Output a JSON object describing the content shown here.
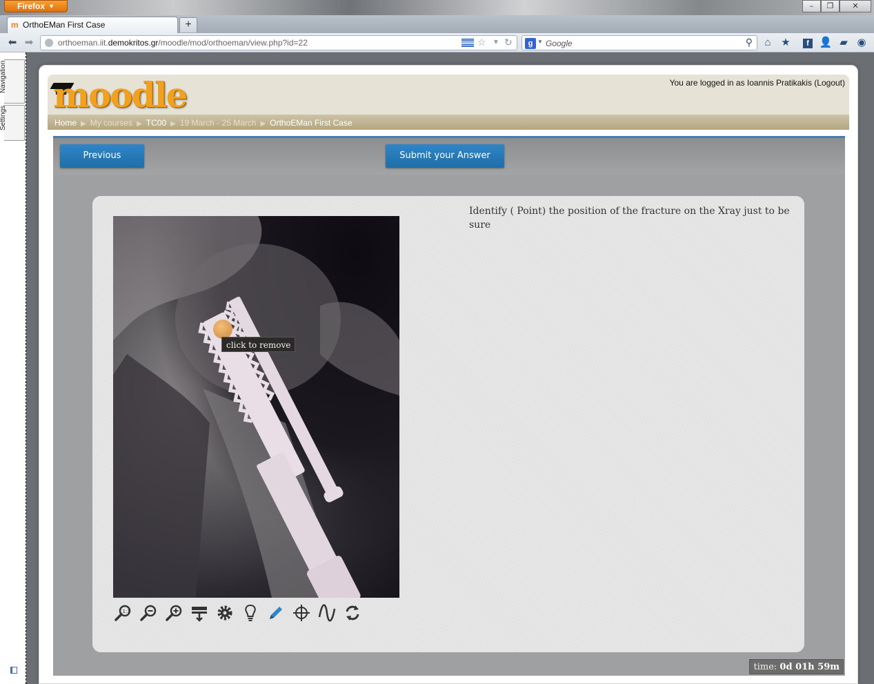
{
  "browser": {
    "app_button": "Firefox",
    "tab_title": "OrthoEMan First Case",
    "url_prefix": "orthoeman.iit.",
    "url_domain": "demokritos.gr",
    "url_path": "/moodle/mod/orthoeman/view.php?id=22",
    "search_placeholder": "Google"
  },
  "sidebar": {
    "tabs": [
      "Navigation",
      "Settings"
    ]
  },
  "header": {
    "logo": "moodle",
    "login_text": "You are logged in as Ioannis Pratikakis (Logout)",
    "breadcrumb": [
      "Home",
      "My courses",
      "TC00",
      "19 March - 25 March",
      "OrthoEMan First Case"
    ]
  },
  "app": {
    "previous_label": "Previous",
    "submit_label": "Submit your Answer",
    "question": "Identify ( Point) the position of the fracture on the Xray just to be sure",
    "tooltip": "click to remove",
    "timer_label": "time:",
    "timer_value": "0d 01h 59m",
    "tools": [
      "zoom-fit-icon",
      "zoom-out-icon",
      "zoom-in-icon",
      "move-icon",
      "gear-icon",
      "lightbulb-icon",
      "pencil-icon",
      "crosshair-icon",
      "curve-icon",
      "rotate-icon"
    ],
    "accent": "#2f86c6"
  }
}
